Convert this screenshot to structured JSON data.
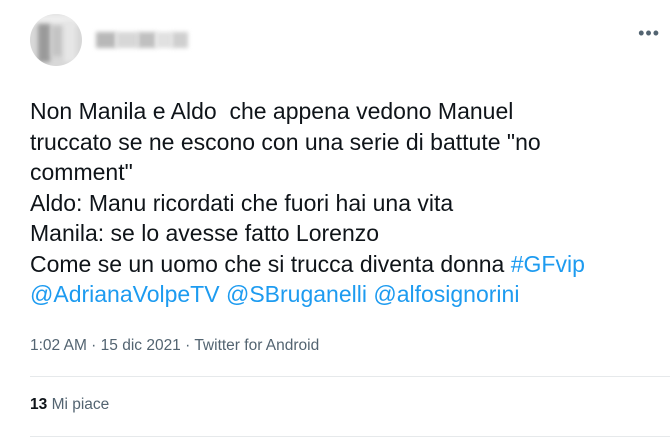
{
  "header": {
    "more_label": "•••"
  },
  "tweet": {
    "lines": [
      "Non Manila e Aldo  che appena vedono Manuel",
      "truccato se ne escono con una serie di battute \"no",
      "comment\"",
      "Aldo: Manu ricordati che fuori hai una vita",
      "Manila: se lo avesse fatto Lorenzo"
    ],
    "line6_text": "Come se un uomo che si trucca diventa donna ",
    "hashtag": "#GFvip",
    "mentions": [
      "@AdrianaVolpeTV",
      "@SBruganelli",
      "@alfosignorini"
    ]
  },
  "meta": {
    "time": "1:02 AM",
    "sep1": " · ",
    "date": "15 dic 2021",
    "sep2": " · ",
    "source": "Twitter for Android"
  },
  "stats": {
    "likes_count": "13",
    "likes_label": "Mi piace"
  },
  "colors": {
    "link": "#1d9bf0",
    "text": "#0f1419",
    "secondary": "#536471"
  }
}
